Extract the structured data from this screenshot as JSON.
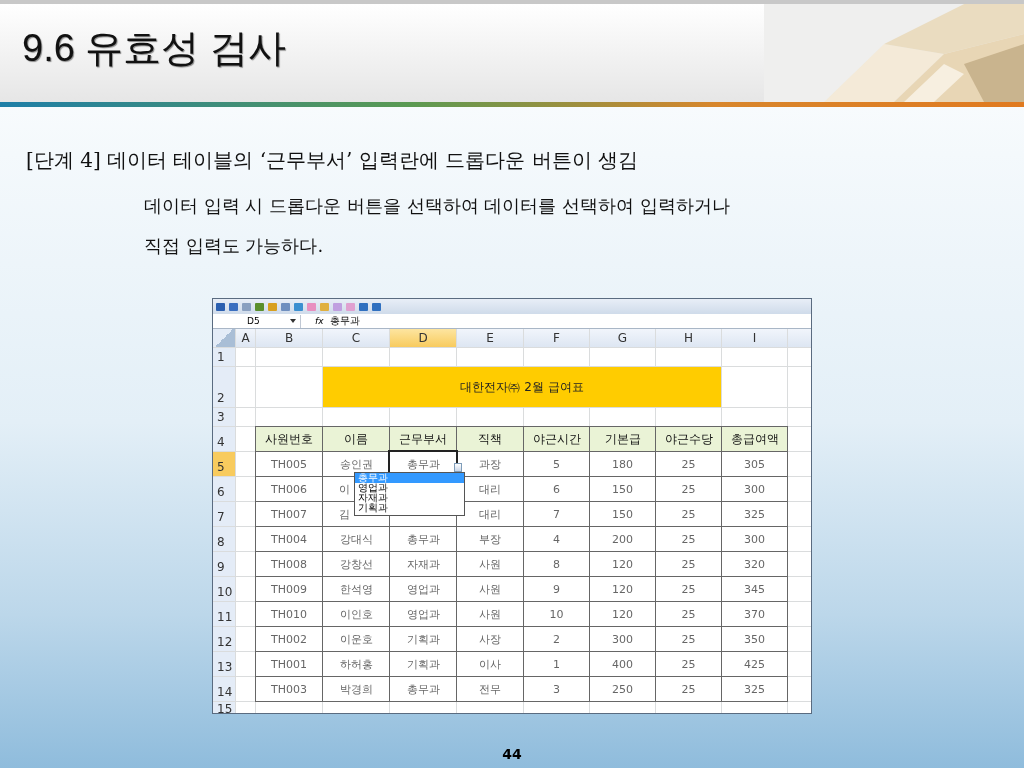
{
  "slide": {
    "title": "9.6 유효성 검사",
    "step": "[단계 4] 데이터 테이블의 ‘근무부서’ 입력란에 드롭다운 버튼이 생김",
    "description": [
      "데이터 입력 시 드롭다운 버튼을 선택하여 데이터를 선택하여 입력하거나",
      "직접 입력도 가능하다."
    ],
    "page_number": "44"
  },
  "excel": {
    "name_box": "D5",
    "formula_label": "fx",
    "formula": "총무과",
    "column_letters": [
      {
        "label": "A",
        "selected": false
      },
      {
        "label": "B",
        "selected": false
      },
      {
        "label": "C",
        "selected": false
      },
      {
        "label": "D",
        "selected": true
      },
      {
        "label": "E",
        "selected": false
      },
      {
        "label": "F",
        "selected": false
      },
      {
        "label": "G",
        "selected": false
      },
      {
        "label": "H",
        "selected": false
      },
      {
        "label": "I",
        "selected": false
      }
    ],
    "row_numbers": [
      {
        "label": "1",
        "selected": false
      },
      {
        "label": "2",
        "selected": false
      },
      {
        "label": "3",
        "selected": false
      },
      {
        "label": "4",
        "selected": false
      },
      {
        "label": "5",
        "selected": true
      },
      {
        "label": "6",
        "selected": false
      },
      {
        "label": "7",
        "selected": false
      },
      {
        "label": "8",
        "selected": false
      },
      {
        "label": "9",
        "selected": false
      },
      {
        "label": "10",
        "selected": false
      },
      {
        "label": "11",
        "selected": false
      },
      {
        "label": "12",
        "selected": false
      },
      {
        "label": "13",
        "selected": false
      },
      {
        "label": "14",
        "selected": false
      },
      {
        "label": "15",
        "selected": false
      }
    ],
    "banner": "대한전자㈜ 2월 급여표",
    "headers": [
      "사원번호",
      "이름",
      "근무부서",
      "직책",
      "야근시간",
      "기본급",
      "야근수당",
      "총급여액"
    ],
    "rows": [
      [
        "TH005",
        "송인권",
        "총무과",
        "과장",
        "5",
        "180",
        "25",
        "305"
      ],
      [
        "TH006",
        "이",
        "",
        "대리",
        "6",
        "150",
        "25",
        "300"
      ],
      [
        "TH007",
        "김",
        "",
        "대리",
        "7",
        "150",
        "25",
        "325"
      ],
      [
        "TH004",
        "강대식",
        "총무과",
        "부장",
        "4",
        "200",
        "25",
        "300"
      ],
      [
        "TH008",
        "강창선",
        "자재과",
        "사원",
        "8",
        "120",
        "25",
        "320"
      ],
      [
        "TH009",
        "한석영",
        "영업과",
        "사원",
        "9",
        "120",
        "25",
        "345"
      ],
      [
        "TH010",
        "이인호",
        "영업과",
        "사원",
        "10",
        "120",
        "25",
        "370"
      ],
      [
        "TH002",
        "이운호",
        "기획과",
        "사장",
        "2",
        "300",
        "25",
        "350"
      ],
      [
        "TH001",
        "하허홍",
        "기획과",
        "이사",
        "1",
        "400",
        "25",
        "425"
      ],
      [
        "TH003",
        "박경희",
        "총무과",
        "전무",
        "3",
        "250",
        "25",
        "325"
      ]
    ],
    "dropdown": [
      {
        "label": "총무과",
        "selected": true
      },
      {
        "label": "영업과",
        "selected": false
      },
      {
        "label": "자재과",
        "selected": false
      },
      {
        "label": "기획과",
        "selected": false
      }
    ]
  }
}
